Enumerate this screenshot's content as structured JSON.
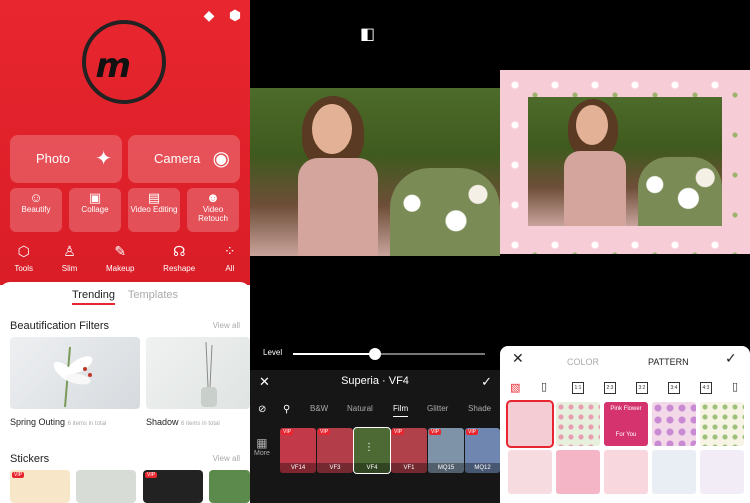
{
  "home": {
    "tools_big": [
      {
        "label": "Photo",
        "icon": "magic-wand-icon"
      },
      {
        "label": "Camera",
        "icon": "camera-icon"
      }
    ],
    "tools_small": [
      {
        "label": "Beautify",
        "icon": "face-icon"
      },
      {
        "label": "Collage",
        "icon": "collage-icon"
      },
      {
        "label": "Video Editing",
        "icon": "video-edit-icon"
      },
      {
        "label": "Video Retouch",
        "icon": "video-retouch-icon"
      }
    ],
    "tool_row": [
      {
        "label": "Tools",
        "icon": "cube-icon"
      },
      {
        "label": "Slim",
        "icon": "person-icon"
      },
      {
        "label": "Makeup",
        "icon": "brush-icon"
      },
      {
        "label": "Reshape",
        "icon": "reshape-icon"
      },
      {
        "label": "All",
        "icon": "grid-icon"
      }
    ],
    "tabs": [
      "Trending",
      "Templates"
    ],
    "section1_title": "Beautification Filters",
    "view_all": "View all",
    "cards": [
      {
        "title": "Spring Outing",
        "meta": "6 items in total"
      },
      {
        "title": "Shadow",
        "meta": "6 items in total"
      }
    ],
    "section2_title": "Stickers"
  },
  "editor": {
    "level_label": "Level",
    "level_value": 0.42,
    "filter_title": "Superia · VF4",
    "categories": [
      "B&W",
      "Natural",
      "Film",
      "Glitter",
      "Shade"
    ],
    "active_category": "Film",
    "more_label": "More",
    "filters": [
      "VF14",
      "VF3",
      "VF4",
      "VF1",
      "MQ15",
      "MQ12"
    ],
    "vip_label": "VIP"
  },
  "frame": {
    "tabs": [
      "COLOR",
      "PATTERN"
    ],
    "active_tab": "PATTERN",
    "ratios": [
      "1:1",
      "2:3",
      "3:2",
      "3:4",
      "4:3"
    ],
    "pattern_banner_text": "Pink Flower",
    "pattern_subtext": "For You"
  },
  "colors": {
    "brand": "#e8262f"
  }
}
